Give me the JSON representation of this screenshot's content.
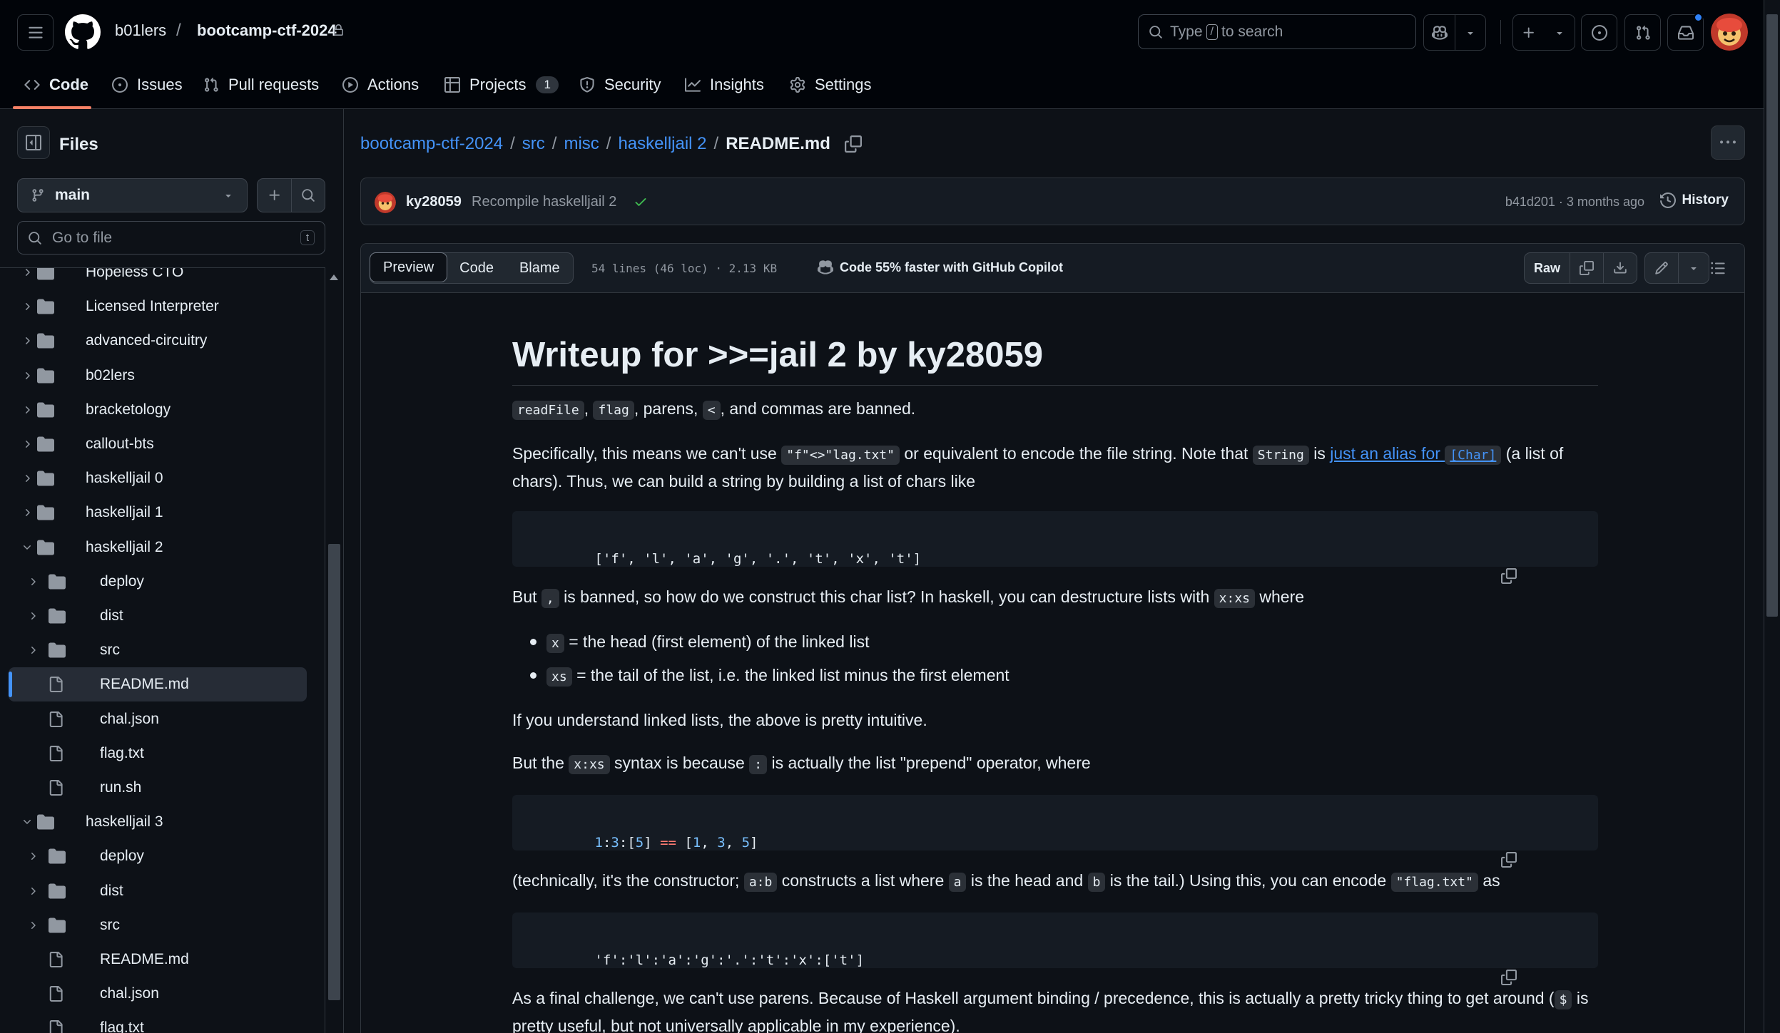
{
  "header": {
    "owner": "b01lers",
    "separator": "/",
    "repo": "bootcamp-ctf-2024",
    "search_prefix": "Type",
    "search_key": "/",
    "search_suffix": "to search"
  },
  "repo_nav": {
    "tabs": [
      {
        "label": "Code",
        "icon": "code-icon"
      },
      {
        "label": "Issues",
        "icon": "issue-opened-icon"
      },
      {
        "label": "Pull requests",
        "icon": "git-pull-request-icon"
      },
      {
        "label": "Actions",
        "icon": "play-icon"
      },
      {
        "label": "Projects",
        "icon": "table-icon",
        "count": "1"
      },
      {
        "label": "Security",
        "icon": "shield-icon"
      },
      {
        "label": "Insights",
        "icon": "graph-icon"
      },
      {
        "label": "Settings",
        "icon": "gear-icon"
      }
    ]
  },
  "sidebar": {
    "title": "Files",
    "branch": "main",
    "goto_placeholder": "Go to file",
    "goto_key": "t",
    "tree": [
      {
        "label": "Hopeless CTO",
        "type": "dir",
        "depth": 0,
        "open": false
      },
      {
        "label": "Licensed Interpreter",
        "type": "dir",
        "depth": 0,
        "open": false
      },
      {
        "label": "advanced-circuitry",
        "type": "dir",
        "depth": 0,
        "open": false
      },
      {
        "label": "b02lers",
        "type": "dir",
        "depth": 0,
        "open": false
      },
      {
        "label": "bracketology",
        "type": "dir",
        "depth": 0,
        "open": false
      },
      {
        "label": "callout-bts",
        "type": "dir",
        "depth": 0,
        "open": false
      },
      {
        "label": "haskelljail 0",
        "type": "dir",
        "depth": 0,
        "open": false
      },
      {
        "label": "haskelljail 1",
        "type": "dir",
        "depth": 0,
        "open": false
      },
      {
        "label": "haskelljail 2",
        "type": "dir",
        "depth": 0,
        "open": true
      },
      {
        "label": "deploy",
        "type": "dir",
        "depth": 1,
        "open": false
      },
      {
        "label": "dist",
        "type": "dir",
        "depth": 1,
        "open": false
      },
      {
        "label": "src",
        "type": "dir",
        "depth": 1,
        "open": false
      },
      {
        "label": "README.md",
        "type": "file",
        "depth": 1,
        "selected": true
      },
      {
        "label": "chal.json",
        "type": "file",
        "depth": 1
      },
      {
        "label": "flag.txt",
        "type": "file",
        "depth": 1
      },
      {
        "label": "run.sh",
        "type": "file",
        "depth": 1
      },
      {
        "label": "haskelljail 3",
        "type": "dir",
        "depth": 0,
        "open": true
      },
      {
        "label": "deploy",
        "type": "dir",
        "depth": 1,
        "open": false
      },
      {
        "label": "dist",
        "type": "dir",
        "depth": 1,
        "open": false
      },
      {
        "label": "src",
        "type": "dir",
        "depth": 1,
        "open": false
      },
      {
        "label": "README.md",
        "type": "file",
        "depth": 1
      },
      {
        "label": "chal.json",
        "type": "file",
        "depth": 1
      },
      {
        "label": "flag.txt",
        "type": "file",
        "depth": 1
      }
    ]
  },
  "breadcrumb": {
    "parts": [
      "bootcamp-ctf-2024",
      "src",
      "misc",
      "haskelljail 2"
    ],
    "sep": "/",
    "current": "README.md"
  },
  "commit": {
    "author": "ky28059",
    "message": "Recompile haskelljail 2",
    "meta": "b41d201 · 3 months ago",
    "history_label": "History"
  },
  "file_toolbar": {
    "tabs": [
      "Preview",
      "Code",
      "Blame"
    ],
    "stats": "54 lines (46 loc) · 2.13 KB",
    "copilot_promo": "Code 55% faster with GitHub Copilot",
    "raw_label": "Raw"
  },
  "markdown": {
    "h1": "Writeup for >>=jail 2 by ky28059",
    "p1": {
      "c1": "readFile",
      "t1": ",",
      "c2": "flag",
      "t2": ", parens,",
      "c3": "<",
      "t3": ", and commas are banned."
    },
    "p2": {
      "t1": "Specifically, this means we can't use",
      "c1": "\"f\"<>\"lag.txt\"",
      "t2": "or equivalent to encode the file string. Note that",
      "c2": "String",
      "t3": "is",
      "link_text": "just an alias for",
      "link_code": "[Char]",
      "t4": "(a list of chars). Thus, we can build a string by building a list of chars like"
    },
    "code1": "['f', 'l', 'a', 'g', '.', 't', 'x', 't']",
    "p3": {
      "t1": "But",
      "c1": ",",
      "t2": "is banned, so how do we construct this char list? In haskell, you can destructure lists with",
      "c2": "x:xs",
      "t3": "where"
    },
    "list": [
      {
        "code": "x",
        "text": "= the head (first element) of the linked list"
      },
      {
        "code": "xs",
        "text": "= the tail of the list, i.e. the linked list minus the first element"
      }
    ],
    "p4": "If you understand linked lists, the above is pretty intuitive.",
    "p5": {
      "t1": "But the",
      "c1": "x:xs",
      "t2": "syntax is because",
      "c2": ":",
      "t3": "is actually the list \"prepend\" operator, where"
    },
    "code2": {
      "a": "1",
      "b": ":",
      "c": "3",
      "d": ":[",
      "e": "5",
      "f": "] ",
      "op": "==",
      "g": " [",
      "h": "1",
      "i": ", ",
      "j": "3",
      "k": ", ",
      "l": "5",
      "m": "]"
    },
    "p6": {
      "t1": "(technically, it's the constructor;",
      "c1": "a:b",
      "t2": "constructs a list where",
      "c2": "a",
      "t3": "is the head and",
      "c3": "b",
      "t4": "is the tail.) Using this, you can encode",
      "c4": "\"flag.txt\"",
      "t5": "as"
    },
    "code3": "'f':'l':'a':'g':'.':'t':'x':['t']",
    "p7": {
      "t1": "As a final challenge, we can't use parens. Because of Haskell argument binding / precedence, this is actually a pretty tricky thing to get around (",
      "c1": "$",
      "t2": "is pretty useful, but not universally applicable in my experience)."
    }
  }
}
